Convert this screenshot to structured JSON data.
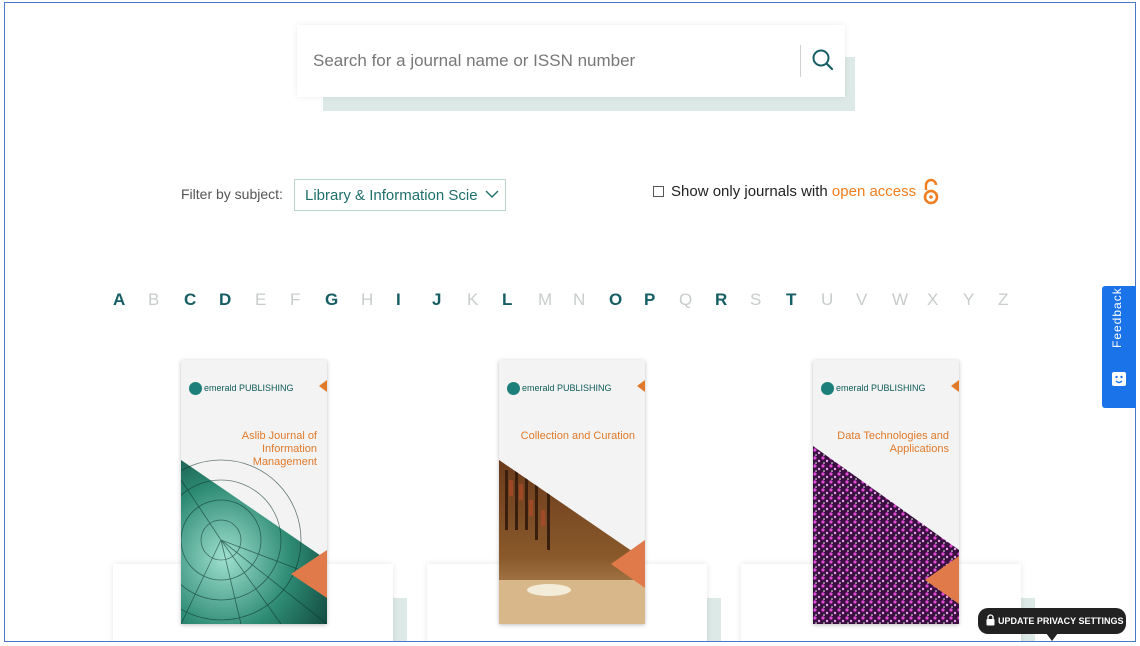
{
  "search": {
    "placeholder": "Search for a journal name or ISSN number",
    "icon": "search-icon"
  },
  "filter": {
    "label": "Filter by subject:",
    "selected": "Library & Information Scie",
    "open_access_prefix": "Show only journals with ",
    "open_access_link": "open access",
    "open_access_checked": false
  },
  "alphabet": [
    {
      "letter": "A",
      "active": true
    },
    {
      "letter": "B",
      "active": false
    },
    {
      "letter": "C",
      "active": true
    },
    {
      "letter": "D",
      "active": true
    },
    {
      "letter": "E",
      "active": false
    },
    {
      "letter": "F",
      "active": false
    },
    {
      "letter": "G",
      "active": true
    },
    {
      "letter": "H",
      "active": false
    },
    {
      "letter": "I",
      "active": true
    },
    {
      "letter": "J",
      "active": true
    },
    {
      "letter": "K",
      "active": false
    },
    {
      "letter": "L",
      "active": true
    },
    {
      "letter": "M",
      "active": false
    },
    {
      "letter": "N",
      "active": false
    },
    {
      "letter": "O",
      "active": true
    },
    {
      "letter": "P",
      "active": true
    },
    {
      "letter": "Q",
      "active": false
    },
    {
      "letter": "R",
      "active": true
    },
    {
      "letter": "S",
      "active": false
    },
    {
      "letter": "T",
      "active": true
    },
    {
      "letter": "U",
      "active": false
    },
    {
      "letter": "V",
      "active": false
    },
    {
      "letter": "W",
      "active": false
    },
    {
      "letter": "X",
      "active": false
    },
    {
      "letter": "Y",
      "active": false
    },
    {
      "letter": "Z",
      "active": false
    }
  ],
  "journals": [
    {
      "title": "Aslib Journal of Information Management",
      "publisher": "emerald PUBLISHING"
    },
    {
      "title": "Collection and Curation",
      "publisher": "emerald PUBLISHING"
    },
    {
      "title": "Data Technologies and Applications",
      "publisher": "emerald PUBLISHING"
    }
  ],
  "feedback": {
    "label": "Feedback"
  },
  "privacy": {
    "label": "UPDATE PRIVACY SETTINGS"
  },
  "colors": {
    "accent": "#155e63",
    "orange": "#f07d1e",
    "feedback": "#1a73e8"
  }
}
